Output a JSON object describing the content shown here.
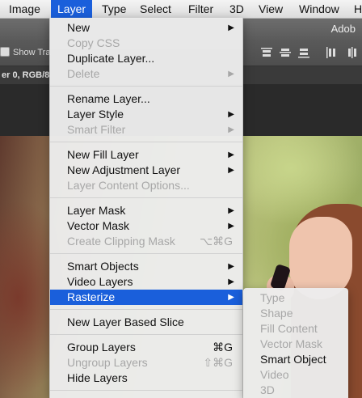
{
  "menubar": {
    "items": [
      {
        "label": "Image"
      },
      {
        "label": "Layer",
        "active": true
      },
      {
        "label": "Type"
      },
      {
        "label": "Select"
      },
      {
        "label": "Filter"
      },
      {
        "label": "3D"
      },
      {
        "label": "View"
      },
      {
        "label": "Window"
      },
      {
        "label": "H"
      }
    ]
  },
  "app": {
    "title": "Adob"
  },
  "options_bar": {
    "show_transform_label": "Show Tra"
  },
  "document": {
    "tab_label": "er 0, RGB/8"
  },
  "layer_menu": {
    "items": [
      {
        "label": "New",
        "submenu": true
      },
      {
        "label": "Copy CSS",
        "disabled": true
      },
      {
        "label": "Duplicate Layer..."
      },
      {
        "label": "Delete",
        "disabled": true,
        "submenu": true
      },
      {
        "label": "Rename Layer..."
      },
      {
        "label": "Layer Style",
        "submenu": true
      },
      {
        "label": "Smart Filter",
        "disabled": true,
        "submenu": true
      },
      {
        "label": "New Fill Layer",
        "submenu": true
      },
      {
        "label": "New Adjustment Layer",
        "submenu": true
      },
      {
        "label": "Layer Content Options...",
        "disabled": true
      },
      {
        "label": "Layer Mask",
        "submenu": true
      },
      {
        "label": "Vector Mask",
        "submenu": true
      },
      {
        "label": "Create Clipping Mask",
        "disabled": true,
        "shortcut": "⌥⌘G"
      },
      {
        "label": "Smart Objects",
        "submenu": true
      },
      {
        "label": "Video Layers",
        "submenu": true
      },
      {
        "label": "Rasterize",
        "submenu": true,
        "highlighted": true
      },
      {
        "label": "New Layer Based Slice"
      },
      {
        "label": "Group Layers",
        "shortcut": "⌘G"
      },
      {
        "label": "Ungroup Layers",
        "disabled": true,
        "shortcut": "⇧⌘G"
      },
      {
        "label": "Hide Layers"
      }
    ]
  },
  "rasterize_submenu": {
    "items": [
      {
        "label": "Type",
        "disabled": true
      },
      {
        "label": "Shape",
        "disabled": true
      },
      {
        "label": "Fill Content",
        "disabled": true
      },
      {
        "label": "Vector Mask",
        "disabled": true
      },
      {
        "label": "Smart Object",
        "disabled": false
      },
      {
        "label": "Video",
        "disabled": true
      },
      {
        "label": "3D",
        "disabled": true
      }
    ]
  },
  "colors": {
    "highlight": "#1a5fdb",
    "disabled_text": "#a7a7a7",
    "menu_bg": "#ececec"
  }
}
